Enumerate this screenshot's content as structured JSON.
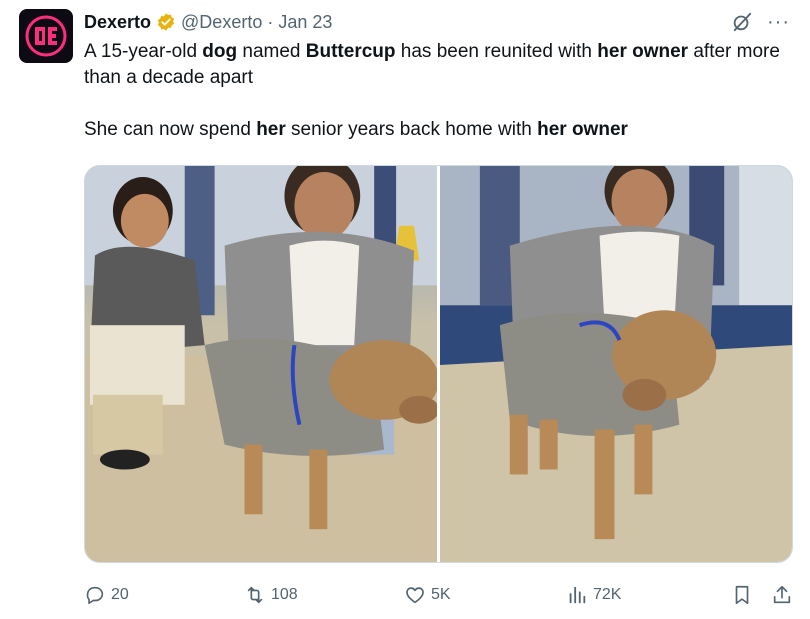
{
  "tweet": {
    "author_name": "Dexerto",
    "handle": "@Dexerto",
    "separator": "·",
    "date": "Jan 23",
    "more_label": "···",
    "paragraph1": [
      {
        "text": "A 15-year-old ",
        "bold": false
      },
      {
        "text": "dog",
        "bold": true
      },
      {
        "text": " named ",
        "bold": false
      },
      {
        "text": "Buttercup",
        "bold": true
      },
      {
        "text": " has been reunited with ",
        "bold": false
      },
      {
        "text": "her owner",
        "bold": true
      },
      {
        "text": " after more than a decade apart",
        "bold": false
      }
    ],
    "paragraph2": [
      {
        "text": "She can now spend ",
        "bold": false
      },
      {
        "text": "her",
        "bold": true
      },
      {
        "text": " senior years back home with ",
        "bold": false
      },
      {
        "text": "her owner",
        "bold": true
      }
    ]
  },
  "metrics": {
    "replies": "20",
    "reposts": "108",
    "likes": "5K",
    "views": "72K"
  },
  "icons": {
    "avatar": "dexerto-logo-icon",
    "verified": "verified-badge-icon",
    "grok": "grok-icon",
    "reply": "reply-icon",
    "repost": "repost-icon",
    "like": "heart-icon",
    "views": "views-icon",
    "bookmark": "bookmark-icon",
    "share": "share-icon"
  },
  "colors": {
    "text": "#0f1419",
    "secondary": "#536471",
    "verified": "#e8b20c",
    "brand": "#e0245e"
  }
}
